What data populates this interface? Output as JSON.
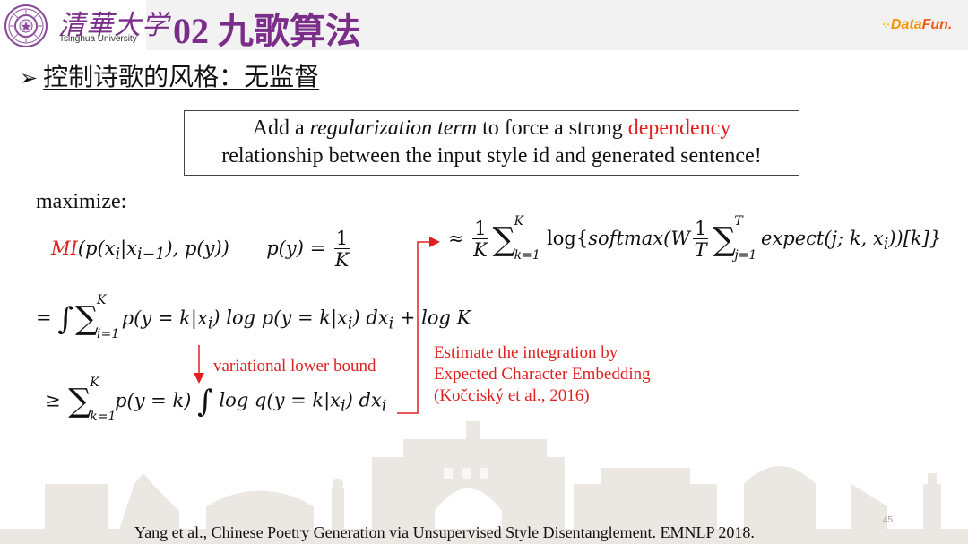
{
  "header": {
    "logo_cn": "清華大学",
    "logo_en": "Tsinghua University",
    "title": "02 九歌算法",
    "brand": {
      "dots": "⁘",
      "data": "Data",
      "fun": "Fun."
    }
  },
  "subtitle": {
    "bullet": "➢",
    "text": "控制诗歌的风格：无监督"
  },
  "callout": {
    "part1": "Add a ",
    "italic": "regularization term",
    "part2": " to force a strong ",
    "red": "dependency",
    "line2": "relationship between the input style id and generated sentence!"
  },
  "maximize_label": "maximize:",
  "equations": {
    "mi": {
      "mi": "MI",
      "rest_a": "(p(x",
      "sub_i": "i",
      "bar": "|x",
      "sub_im1": "i−1",
      "rest_b": "), p(y))"
    },
    "py": {
      "lhs": "p(y) =",
      "num": "1",
      "den": "K"
    },
    "approx": {
      "approx": "≈",
      "num": "1",
      "den": "K",
      "sum_sup": "K",
      "sum_sub": "k=1",
      "log_open": "log{",
      "softmax": "softmax",
      "w": "(W",
      "num2": "1",
      "den2": "T",
      "sum2_sup": "T",
      "sum2_sub": "j=1",
      "expect": "expect",
      "args": "(j; k, x",
      "args_sub": "i",
      "close": "))[k]}"
    },
    "equals": {
      "eq": "=",
      "integral": "∫",
      "sum_sup": "K",
      "sum_sub": "i=1",
      "body": "p(y = k|x",
      "sub1": "i",
      "mid": ") log p(y = k|x",
      "sub2": "i",
      "dx": ") dx",
      "sub3": "i",
      "tail": " + log K"
    },
    "geq": {
      "geq": "≥",
      "sum_sup": "K",
      "sum_sub": "k=1",
      "body": "p(y = k)",
      "integral": "∫",
      "log": " log q(y = k|x",
      "sub1": "i",
      "dx": ") dx",
      "sub2": "i"
    }
  },
  "notes": {
    "lower_bound": "variational lower bound",
    "estimate": [
      "Estimate the integration by",
      "Expected Character Embedding",
      "(Kočciský et al., 2016)"
    ]
  },
  "citation": "Yang et al., Chinese Poetry Generation via Unsupervised Style Disentanglement. EMNLP 2018.",
  "page_number": "45",
  "colors": {
    "title_purple": "#7a2e8a",
    "accent_red": "#e02020",
    "header_gray": "#f2f2f2",
    "skyline": "#ebe7e2"
  }
}
